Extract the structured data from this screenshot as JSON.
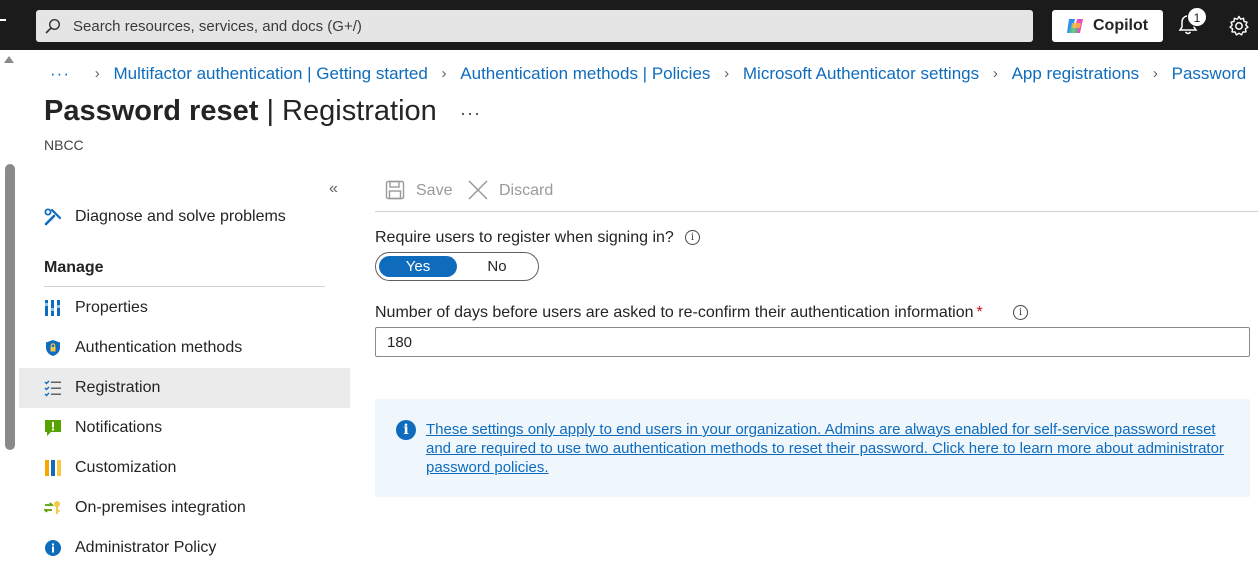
{
  "topbar": {
    "search_placeholder": "Search resources, services, and docs (G+/)",
    "copilot_label": "Copilot",
    "notification_count": "1"
  },
  "breadcrumb": {
    "more": "···",
    "items": [
      "Multifactor authentication | Getting started",
      "Authentication methods | Policies",
      "Microsoft Authenticator settings",
      "App registrations",
      "Password"
    ]
  },
  "header": {
    "title_main": "Password reset",
    "title_sep": " | ",
    "title_sub": "Registration",
    "more": "···",
    "subtitle": "NBCC"
  },
  "sidebar": {
    "collapse": "«",
    "diagnose": "Diagnose and solve problems",
    "manage_heading": "Manage",
    "items": [
      {
        "label": "Properties",
        "icon": "properties-icon"
      },
      {
        "label": "Authentication methods",
        "icon": "shield-icon"
      },
      {
        "label": "Registration",
        "icon": "checklist-icon",
        "selected": true
      },
      {
        "label": "Notifications",
        "icon": "notification-icon"
      },
      {
        "label": "Customization",
        "icon": "customization-icon"
      },
      {
        "label": "On-premises integration",
        "icon": "sync-key-icon"
      },
      {
        "label": "Administrator Policy",
        "icon": "info-icon"
      }
    ]
  },
  "toolbar": {
    "save_label": "Save",
    "discard_label": "Discard"
  },
  "form": {
    "require_label": "Require users to register when signing in?",
    "toggle_yes": "Yes",
    "toggle_no": "No",
    "toggle_selected": "Yes",
    "days_label": "Number of days before users are asked to re-confirm their authentication information",
    "required_mark": "*",
    "days_value": "180"
  },
  "banner": {
    "text": "These settings only apply to end users in your organization. Admins are always enabled for self-service password reset and are required to use two authentication methods to reset their password. Click here to learn more about administrator password policies."
  },
  "colors": {
    "accent": "#0f6cbd",
    "topbar": "#1b1b1b",
    "banner_bg": "#eff6fc",
    "selected_bg": "#ebebeb"
  }
}
